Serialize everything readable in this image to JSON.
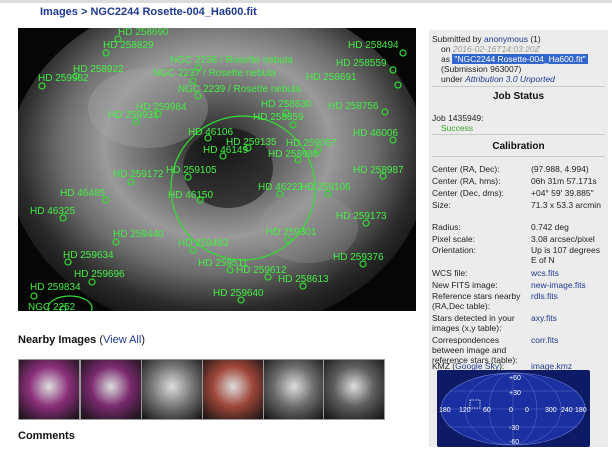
{
  "breadcrumb": {
    "images_link": "Images",
    "separator": " > ",
    "current": "NGC2244 Rosette-004_Ha600.fit"
  },
  "annotations": [
    {
      "label": "HD 258690"
    },
    {
      "label": "HD 258829"
    },
    {
      "label": "HD 258922"
    },
    {
      "label": "HD 259982"
    },
    {
      "label": "NGC 2238 / Rosette nebula"
    },
    {
      "label": "NGC 2237 / Rosette nebula"
    },
    {
      "label": "NGC 2239 / Rosette nebula"
    },
    {
      "label": "HD 258494"
    },
    {
      "label": "HD 258559"
    },
    {
      "label": "HD 258691"
    },
    {
      "label": "HD 258756"
    },
    {
      "label": "HD 259984"
    },
    {
      "label": "HD 259931"
    },
    {
      "label": "HD 258830"
    },
    {
      "label": "HD 258859"
    },
    {
      "label": "HD 259135"
    },
    {
      "label": "HD 46106"
    },
    {
      "label": "HD 46149"
    },
    {
      "label": "HD 46006"
    },
    {
      "label": "HD 259057"
    },
    {
      "label": "HD 258986"
    },
    {
      "label": "HD 259172"
    },
    {
      "label": "HD 259105"
    },
    {
      "label": "HD 46223"
    },
    {
      "label": "HD 259106"
    },
    {
      "label": "HD 258987"
    },
    {
      "label": "HD 46150"
    },
    {
      "label": "HD 46485"
    },
    {
      "label": "HD 46325"
    },
    {
      "label": "HD 259173"
    },
    {
      "label": "HD 259440"
    },
    {
      "label": "HD 259483"
    },
    {
      "label": "HD 259301"
    },
    {
      "label": "HD 259634"
    },
    {
      "label": "HD 259376"
    },
    {
      "label": "HD 259511"
    },
    {
      "label": "HD 259696"
    },
    {
      "label": "HD 259612"
    },
    {
      "label": "HD 258613"
    },
    {
      "label": "HD 259834"
    },
    {
      "label": "HD 259640"
    },
    {
      "label": "NGC 2252"
    }
  ],
  "nearby": {
    "title": "Nearby Images",
    "view_all": "View All"
  },
  "thumbnails": [
    {
      "label": "nearby-1",
      "color": "#8a2f7a"
    },
    {
      "label": "nearby-2",
      "color": "#7a2a6e"
    },
    {
      "label": "nearby-3",
      "color": "#7a7a7a"
    },
    {
      "label": "nearby-4",
      "color": "#a0473a"
    },
    {
      "label": "nearby-5",
      "color": "#6d6d6d"
    },
    {
      "label": "nearby-6",
      "color": "#5f5f5f"
    }
  ],
  "comments": {
    "title": "Comments"
  },
  "submission": {
    "submitted_by": "Submitted by",
    "user": "anonymous",
    "count": "(1)",
    "on_label": "on",
    "date": "2016-02-16T14:03:20Z",
    "as_label": "as",
    "filename": "\"NGC2244 Rosette-004_Ha600.fit\"",
    "submission_id": "(Submission 963007)",
    "under_label": "under",
    "license": "Attribution 3.0 Unported"
  },
  "job_status": {
    "title": "Job Status",
    "job": "Job 1435949:",
    "status": "Success"
  },
  "calibration": {
    "title": "Calibration",
    "rows": [
      {
        "label": "Center (RA, Dec):",
        "value": "(97.988, 4.994)"
      },
      {
        "label": "Center (RA, hms):",
        "value": "06h 31m 57.171s"
      },
      {
        "label": "Center (Dec, dms):",
        "value": "+04° 59' 39.885\""
      },
      {
        "label": "Size:",
        "value": "71.3 x 53.3 arcmin"
      },
      {
        "label": "Radius:",
        "value": "0.742 deg"
      },
      {
        "label": "Pixel scale:",
        "value": "3.08 arcsec/pixel"
      },
      {
        "label": "Orientation:",
        "value": "Up is 107 degrees E of N"
      },
      {
        "label": "WCS file:",
        "value": "wcs.fits"
      },
      {
        "label": "New FITS image:",
        "value": "new-image.fits"
      },
      {
        "label": "Reference stars nearby (RA,Dec table):",
        "value": "rdls.fits"
      },
      {
        "label": "Stars detected in your images (x,y table):",
        "value": "axy.fits"
      },
      {
        "label": "Correspondences between image and reference stars (table):",
        "value": "corr.fits"
      },
      {
        "label": "KMZ (Google Sky):",
        "value": "image.kmz"
      }
    ]
  },
  "sky_map": {
    "ticks": [
      "+60",
      "+30",
      "0",
      "-30",
      "-60",
      "180",
      "120",
      "60",
      "0",
      "300",
      "240",
      "180"
    ]
  }
}
